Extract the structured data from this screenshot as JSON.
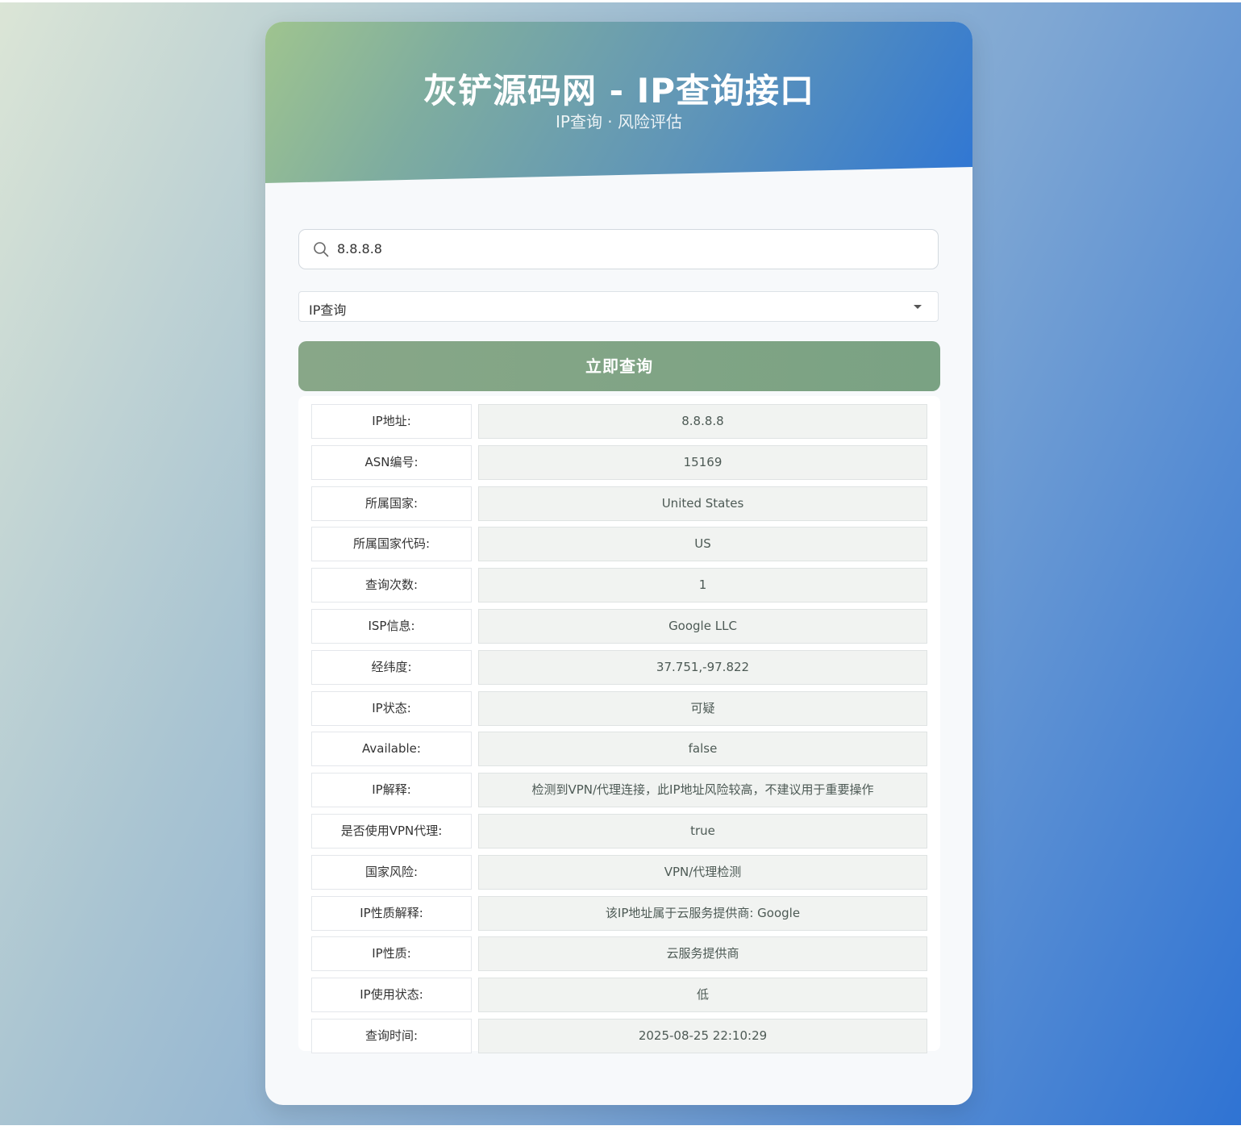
{
  "header": {
    "title": "灰铲源码网 - IP查询接口",
    "subtitle": "IP查询 · 风险评估"
  },
  "search": {
    "value": "8.8.8.8",
    "icon": "search-icon"
  },
  "query_type": {
    "selected": "IP查询"
  },
  "submit_label": "立即查询",
  "results": [
    {
      "label": "IP地址:",
      "value": "8.8.8.8"
    },
    {
      "label": "ASN编号:",
      "value": "15169"
    },
    {
      "label": "所属国家:",
      "value": "United States"
    },
    {
      "label": "所属国家代码:",
      "value": "US"
    },
    {
      "label": "查询次数:",
      "value": "1"
    },
    {
      "label": "ISP信息:",
      "value": "Google LLC"
    },
    {
      "label": "经纬度:",
      "value": "37.751,-97.822"
    },
    {
      "label": "IP状态:",
      "value": "可疑"
    },
    {
      "label": "Available:",
      "value": "false"
    },
    {
      "label": "IP解释:",
      "value": "检测到VPN/代理连接，此IP地址风险较高，不建议用于重要操作"
    },
    {
      "label": "是否使用VPN代理:",
      "value": "true"
    },
    {
      "label": "国家风险:",
      "value": "VPN/代理检测"
    },
    {
      "label": "IP性质解释:",
      "value": "该IP地址属于云服务提供商: Google"
    },
    {
      "label": "IP性质:",
      "value": "云服务提供商"
    },
    {
      "label": "IP使用状态:",
      "value": "低"
    },
    {
      "label": "查询时间:",
      "value": "2025-08-25 22:10:29"
    }
  ]
}
